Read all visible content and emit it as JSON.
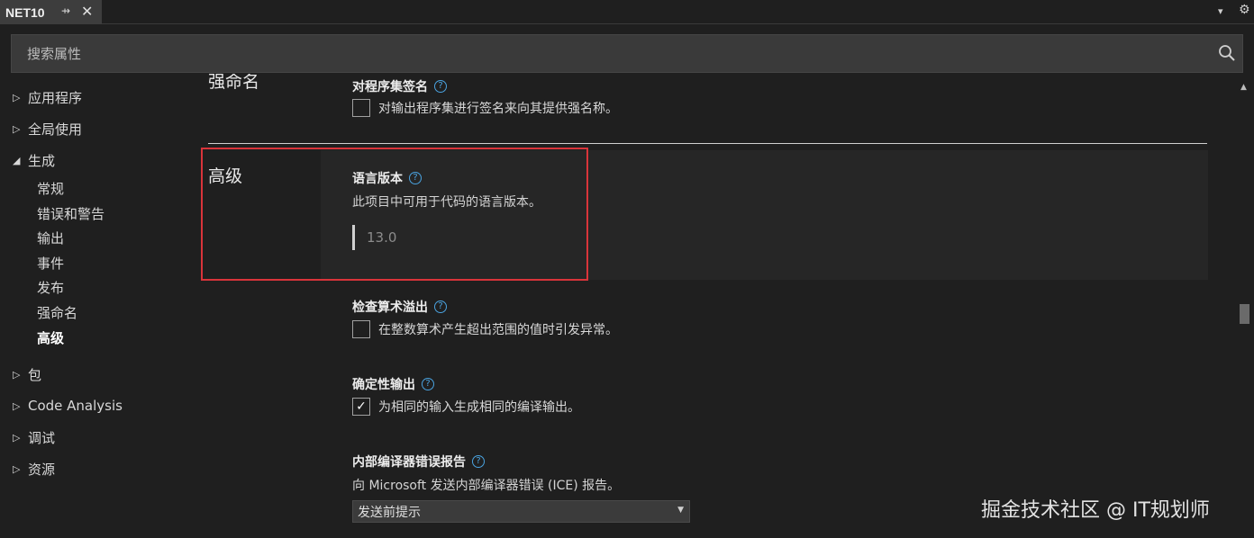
{
  "tab": {
    "title": "NET10",
    "pin": "⇸",
    "close": "✕"
  },
  "toolbar": {
    "chevron": "▾",
    "gear": "⚙"
  },
  "search": {
    "placeholder": "搜索属性",
    "icon": "search-icon"
  },
  "sidebar": {
    "items": [
      {
        "label": "应用程序",
        "arrow": "▷"
      },
      {
        "label": "全局使用",
        "arrow": "▷"
      },
      {
        "label": "生成",
        "arrow": "◢"
      },
      {
        "label": "包",
        "arrow": "▷"
      },
      {
        "label": "Code Analysis",
        "arrow": "▷"
      },
      {
        "label": "调试",
        "arrow": "▷"
      },
      {
        "label": "资源",
        "arrow": "▷"
      }
    ],
    "build_children": [
      "常规",
      "错误和警告",
      "输出",
      "事件",
      "发布",
      "强命名",
      "高级"
    ],
    "active": "高级"
  },
  "main": {
    "strong_name_section": "强命名",
    "sign_assembly": {
      "title": "对程序集签名",
      "checkbox_label": "对输出程序集进行签名来向其提供强名称。",
      "checked": false
    },
    "advanced_section": "高级",
    "lang_version": {
      "title": "语言版本",
      "desc": "此项目中可用于代码的语言版本。",
      "value": "13.0"
    },
    "check_overflow": {
      "title": "检查算术溢出",
      "checkbox_label": "在整数算术产生超出范围的值时引发异常。",
      "checked": false
    },
    "deterministic": {
      "title": "确定性输出",
      "checkbox_label": "为相同的输入生成相同的编译输出。",
      "checked": true,
      "checkmark": "✓"
    },
    "ice_report": {
      "title": "内部编译器错误报告",
      "desc": "向 Microsoft 发送内部编译器错误 (ICE) 报告。",
      "selected": "发送前提示",
      "arrow": "▼"
    },
    "help_glyph": "?"
  },
  "scrollbar": {
    "up": "▲"
  },
  "watermark": "掘金技术社区 @ IT规划师",
  "colors": {
    "highlight": "#d9343a",
    "help": "#4aa3e0",
    "background": "#1f1f1f"
  }
}
